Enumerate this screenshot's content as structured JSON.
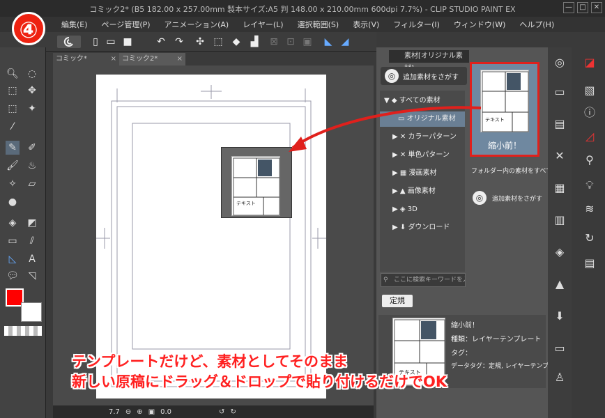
{
  "window": {
    "title": "コミック2* (B5 182.00 x 257.00mm 製本サイズ:A5 判 148.00 x 210.00mm 600dpi 7.7%) - CLIP STUDIO PAINT EX",
    "minimize": "—",
    "maximize": "□",
    "close": "✕"
  },
  "step_badge": "④",
  "menu": [
    "編集(E)",
    "ページ管理(P)",
    "アニメーション(A)",
    "レイヤー(L)",
    "選択範囲(S)",
    "表示(V)",
    "フィルター(I)",
    "ウィンドウ(W)",
    "ヘルプ(H)"
  ],
  "tabs": [
    {
      "label": "コミック*",
      "close": "×",
      "active": false
    },
    {
      "label": "コミック2*",
      "close": "×",
      "active": true
    }
  ],
  "status": {
    "zoom": "7.7",
    "angle": "0.0"
  },
  "material_panel": {
    "header": "素材[オリジナル素材]",
    "search_more": "追加素材をさがす",
    "tree": [
      {
        "label": "すべての素材",
        "level": 0,
        "expanded": true
      },
      {
        "label": "オリジナル素材",
        "level": 1,
        "selected": true
      },
      {
        "label": "カラーパターン",
        "level": 1
      },
      {
        "label": "単色パターン",
        "level": 1
      },
      {
        "label": "漫画素材",
        "level": 1
      },
      {
        "label": "画像素材",
        "level": 1
      },
      {
        "label": "3D",
        "level": 1
      },
      {
        "label": "ダウンロード",
        "level": 1
      }
    ],
    "search_placeholder": "ここに検索キーワードを入力",
    "tag": "定規",
    "thumb_label": "縮小前！",
    "folder_note": "フォルダー内の素材をすべて",
    "search_more2": "追加素材をさがす",
    "thumb_text": "テキスト"
  },
  "info": {
    "name": "縮小前！",
    "kind": "種類：レイヤーテンプレート",
    "tag": "タグ：",
    "datatag": "データタグ：定規, レイヤーテンプレート"
  },
  "overlay": {
    "line1": "テンプレートだけど、素材としてそのまま",
    "line2": "新しい原稿にドラッグ＆ドロップで貼り付けるだけでOK"
  },
  "colors": {
    "highlight": "#e0201c",
    "main_color": "#ff0000",
    "panel_bg": "#555555"
  }
}
